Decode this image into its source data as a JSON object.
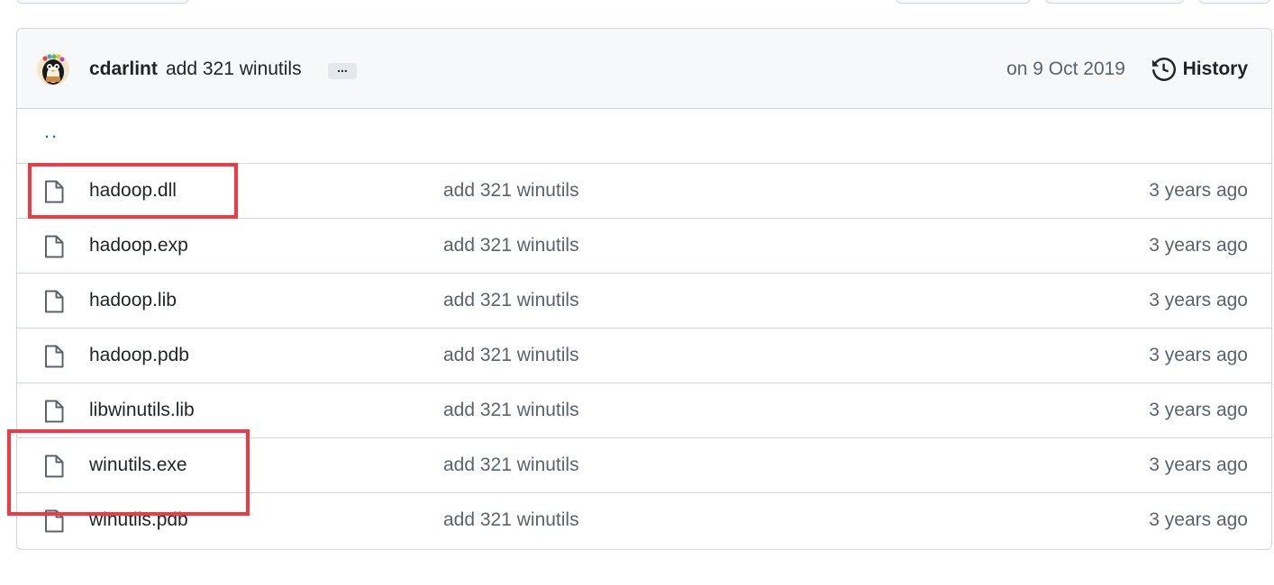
{
  "header": {
    "author": "cdarlint",
    "message": "add 321 winutils",
    "ellipsis": "...",
    "date": "on 9 Oct 2019",
    "history_label": "History"
  },
  "parent_dir": "..",
  "files": [
    {
      "name": "hadoop.dll",
      "message": "add 321 winutils",
      "age": "3 years ago"
    },
    {
      "name": "hadoop.exp",
      "message": "add 321 winutils",
      "age": "3 years ago"
    },
    {
      "name": "hadoop.lib",
      "message": "add 321 winutils",
      "age": "3 years ago"
    },
    {
      "name": "hadoop.pdb",
      "message": "add 321 winutils",
      "age": "3 years ago"
    },
    {
      "name": "libwinutils.lib",
      "message": "add 321 winutils",
      "age": "3 years ago"
    },
    {
      "name": "winutils.exe",
      "message": "add 321 winutils",
      "age": "3 years ago"
    },
    {
      "name": "winutils.pdb",
      "message": "add 321 winutils",
      "age": "3 years ago"
    }
  ],
  "colors": {
    "highlight": "#ee3a43",
    "link": "#0969da",
    "muted": "#59636e"
  },
  "icons": {
    "file": "file-icon",
    "history": "history-icon",
    "avatar": "penguin-avatar"
  },
  "highlighted_files": [
    "hadoop.dll",
    "winutils.exe"
  ]
}
